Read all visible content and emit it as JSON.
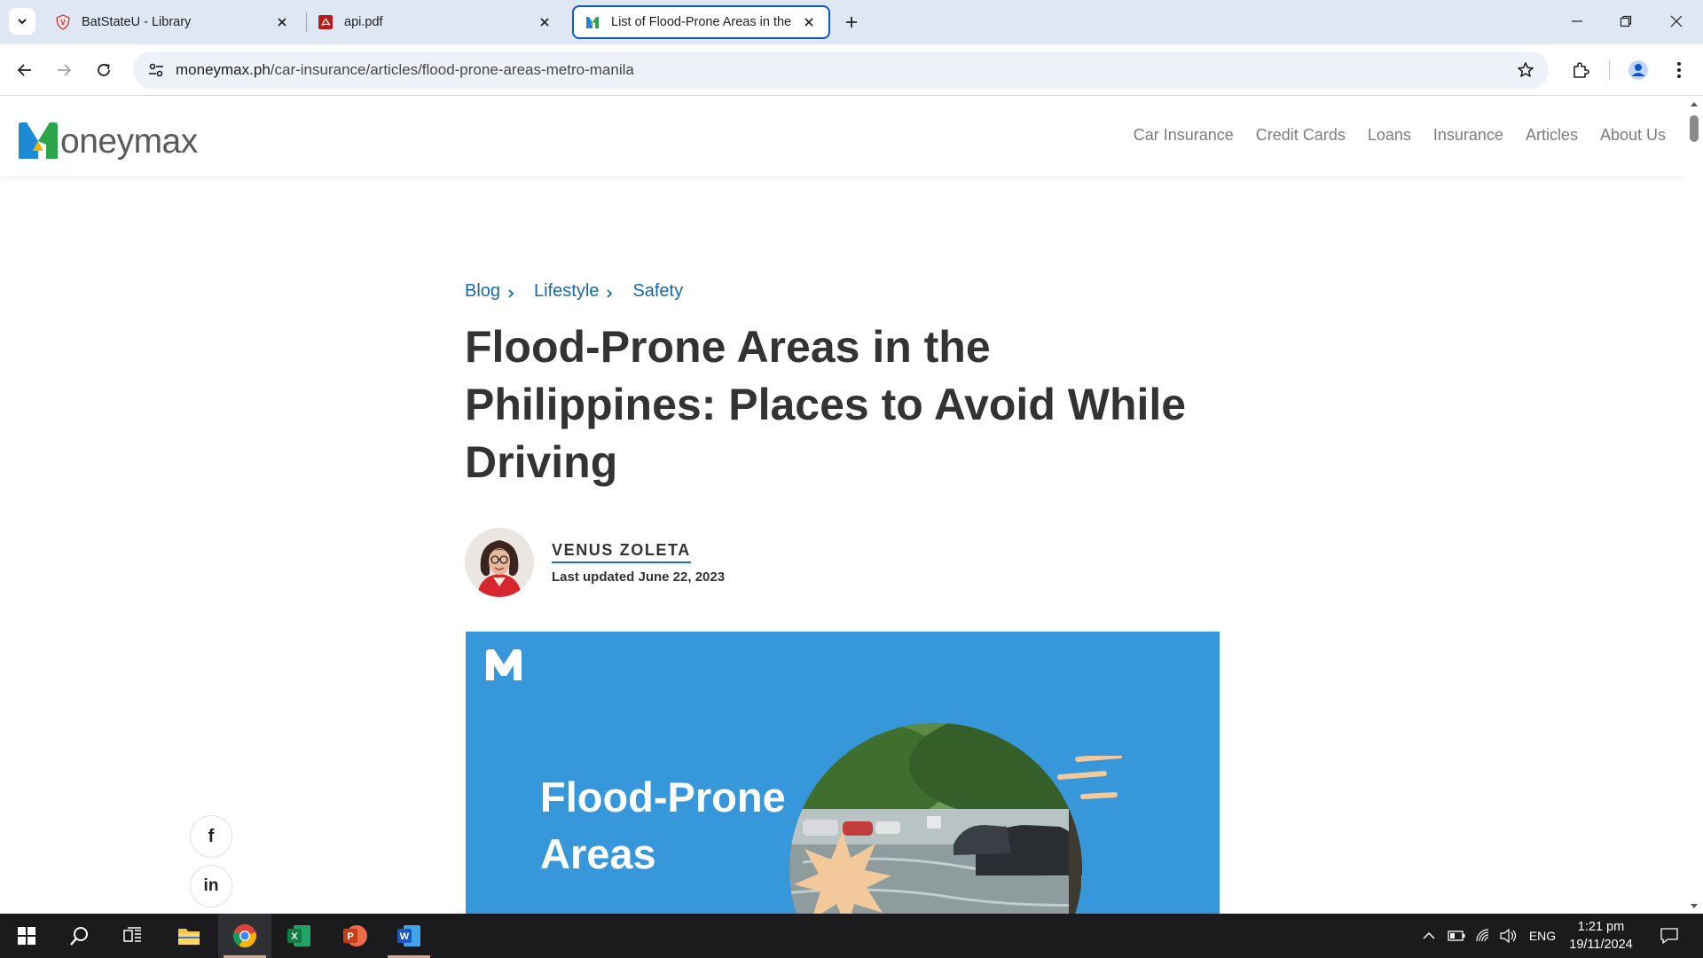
{
  "browser": {
    "tabs": [
      {
        "title": "BatStateU - Library",
        "active": false
      },
      {
        "title": "api.pdf",
        "active": false
      },
      {
        "title": "List of Flood-Prone Areas in the",
        "active": true
      }
    ],
    "url_domain": "moneymax.ph",
    "url_path": "/car-insurance/articles/flood-prone-areas-metro-manila"
  },
  "site": {
    "logo_letter": "M",
    "logo_text": "oneymax",
    "nav": [
      "Car Insurance",
      "Credit Cards",
      "Loans",
      "Insurance",
      "Articles",
      "About Us"
    ]
  },
  "article": {
    "breadcrumb": [
      "Blog",
      "Lifestyle",
      "Safety"
    ],
    "title": "Flood-Prone Areas in the Philippines: Places to Avoid While Driving",
    "author_name": "VENUS ZOLETA",
    "updated": "Last updated June 22, 2023",
    "hero_line1": "Flood-Prone",
    "hero_line2": "Areas"
  },
  "share": {
    "facebook_label": "f",
    "linkedin_label": "in"
  },
  "taskbar": {
    "language": "ENG",
    "time": "1:21 pm",
    "date": "19/11/2024"
  },
  "colors": {
    "accent_blue": "#0b57d0",
    "link_blue": "#1769a8",
    "hero_blue": "#3797db",
    "logo_blue": "#1d8ad6",
    "logo_green": "#2aa54a",
    "logo_yellow": "#f5b400"
  }
}
